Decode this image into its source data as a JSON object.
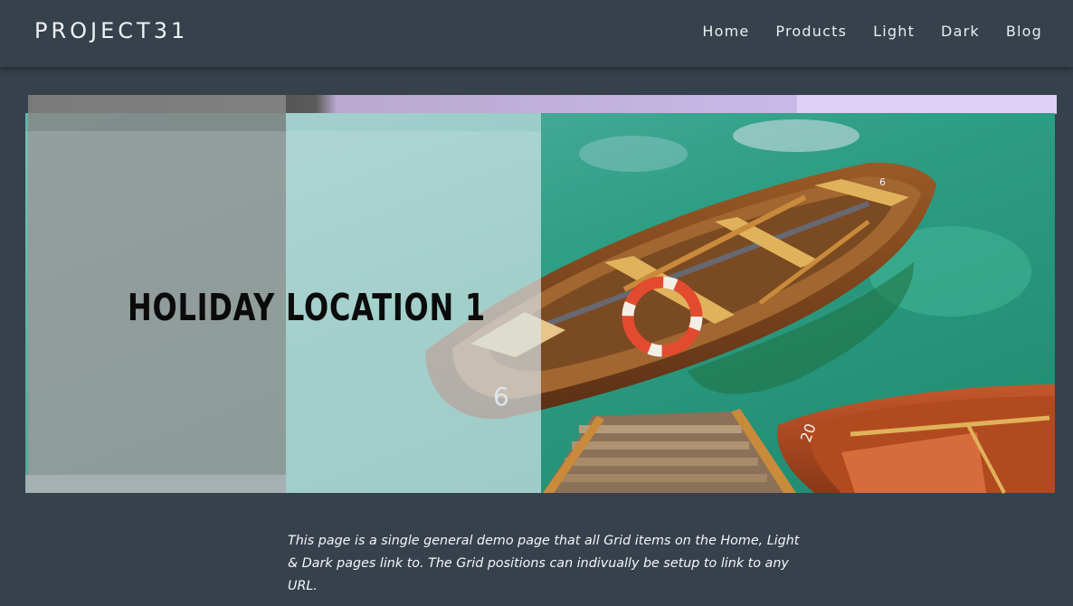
{
  "header": {
    "logo": "PROJECT31",
    "nav": [
      {
        "label": "Home"
      },
      {
        "label": "Products"
      },
      {
        "label": "Light"
      },
      {
        "label": "Dark"
      },
      {
        "label": "Blog"
      }
    ]
  },
  "hero": {
    "title": "HOLIDAY LOCATION 1",
    "boat_numbers": [
      "6",
      "20"
    ]
  },
  "caption": {
    "text": "This page is a single general demo page that all Grid items on the Home, Light & Dark pages link to. The Grid positions can indivually be setup to link to any URL."
  },
  "colors": {
    "background": "#36414b",
    "water": "#2e9e84",
    "accent_lilac": "#ddd1f7"
  }
}
